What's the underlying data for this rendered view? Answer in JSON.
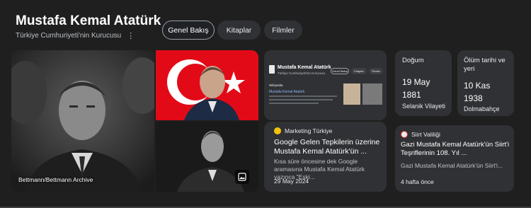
{
  "header": {
    "title": "Mustafa Kemal Atatürk",
    "subtitle": "Türkiye Cumhuriyeti'nin Kurucusu"
  },
  "tabs": [
    {
      "label": "Genel Bakış",
      "active": true
    },
    {
      "label": "Kitaplar",
      "active": false
    },
    {
      "label": "Filmler",
      "active": false
    }
  ],
  "images": {
    "main_caption": "Bettmann/Bettmann Archive"
  },
  "preview_card": {
    "title": "Mustafa Kemal Atatürk",
    "subtitle": "Türkiye Cumhuriyeti'nin Kurucusu",
    "chips": [
      "Genel Bakış",
      "Kitaplar",
      "Filmler"
    ],
    "source": "Wikipedia",
    "link": "Mustafa Kemal Atatürk"
  },
  "facts": {
    "birth": {
      "label": "Doğum",
      "date": "19 May",
      "year": "1881",
      "place": "Selanik Vilayeti"
    },
    "death": {
      "label": "Ölüm tarihi ve yeri",
      "date": "10 Kas",
      "year": "1938",
      "place": "Dolmabahçe"
    }
  },
  "news": [
    {
      "source": "Marketing Türkiye",
      "headline": "Google Gelen Tepkilerin üzerine Mustafa Kemal Atatürk'ün ...",
      "snippet": "Kısa süre öncesine dek Google aramasına Mustafa Kemal Atatürk yazınca \"Eski...",
      "date": "29 May 2024",
      "icon_color": "#f4c20d"
    },
    {
      "source": "Siirt Valiliği",
      "headline": "Gazi Mustafa Kemal Atatürk'ün Siirt'i Teşriflerinin 108. Yıl ...",
      "snippet": "Gazi Mustafa Kemal Atatürk'ün Siirt'i...",
      "date": "4 hafta önce",
      "icon_color": "#e8eaed"
    }
  ],
  "colors": {
    "background": "#1f1f1f",
    "card": "#303134",
    "flag_red": "#e30a17"
  }
}
